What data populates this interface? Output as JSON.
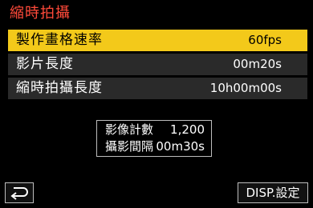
{
  "header": {
    "title": "縮時拍攝"
  },
  "menu": {
    "items": [
      {
        "label": "製作畫格速率",
        "value": "60fps",
        "selected": true
      },
      {
        "label": "影片長度",
        "value": "00m20s",
        "selected": false
      },
      {
        "label": "縮時拍攝長度",
        "value": "10h00m00s",
        "selected": false
      }
    ]
  },
  "info": {
    "image_count_label": "影像計數",
    "image_count_value": "1,200",
    "interval_label": "攝影間隔",
    "interval_value": "00m30s"
  },
  "footer": {
    "back_icon": "return-arrow-icon",
    "disp_label": "DISP.設定"
  },
  "colors": {
    "title": "#ff4a3a",
    "selected_bg": "#f3c91a",
    "row_bg": "#2a2a2a"
  }
}
